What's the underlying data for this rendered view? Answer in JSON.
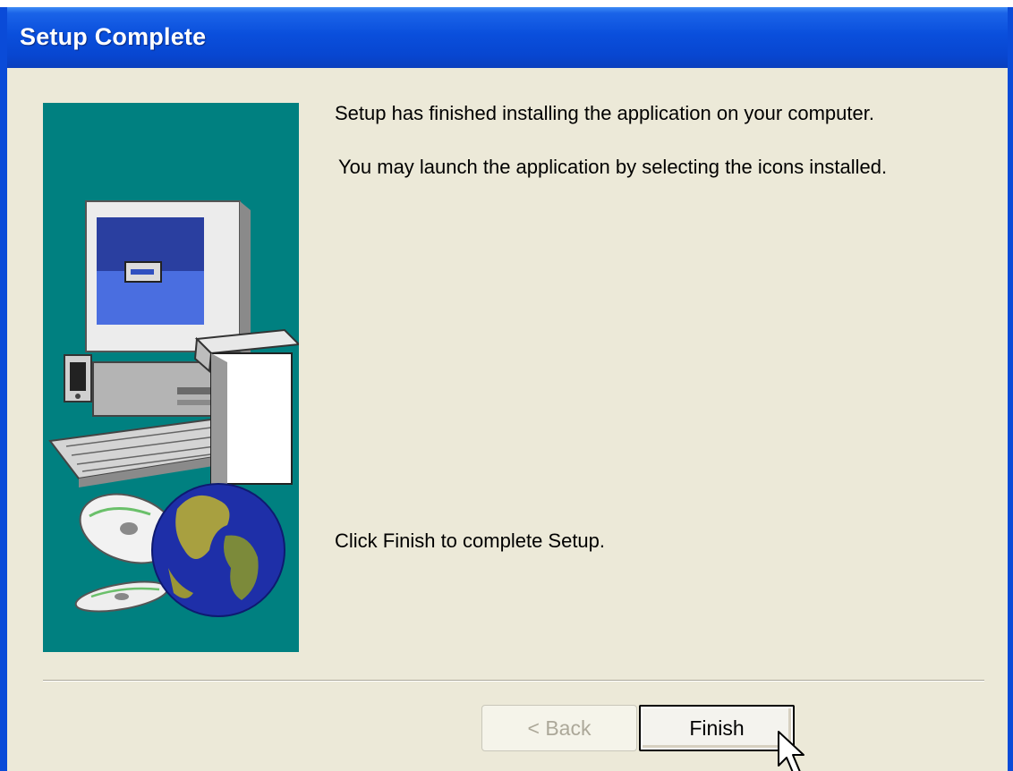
{
  "window": {
    "title": "Setup Complete"
  },
  "content": {
    "message_line1": "Setup has finished installing the application on your computer.",
    "message_line2": "You may launch the application by selecting the icons installed.",
    "message_line3": "Click Finish to complete Setup."
  },
  "buttons": {
    "back_label": "< Back",
    "finish_label": "Finish"
  },
  "colors": {
    "titlebar": "#0a4fdc",
    "dialog_background": "#ece9d8",
    "panel_teal": "#008080"
  },
  "icons": {
    "side_panel": "computer-cd-globe-illustration",
    "cursor": "arrow-cursor"
  }
}
